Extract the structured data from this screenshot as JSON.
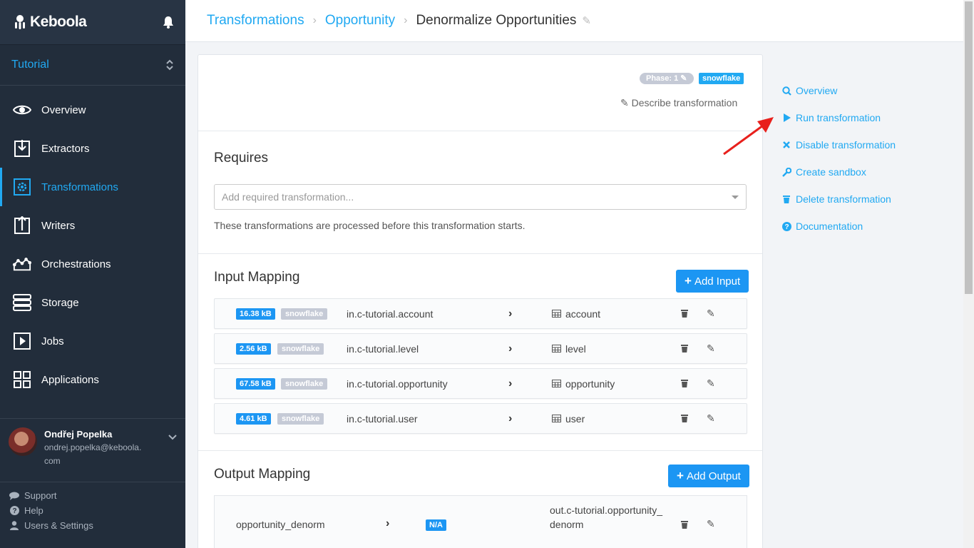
{
  "app": {
    "logo_text": "Keboola"
  },
  "project": {
    "name": "Tutorial"
  },
  "sidebar": {
    "items": [
      {
        "label": "Overview",
        "icon": "eye-icon"
      },
      {
        "label": "Extractors",
        "icon": "download-icon"
      },
      {
        "label": "Transformations",
        "icon": "gear-icon",
        "active": true
      },
      {
        "label": "Writers",
        "icon": "upload-icon"
      },
      {
        "label": "Orchestrations",
        "icon": "orchestration-icon"
      },
      {
        "label": "Storage",
        "icon": "storage-icon"
      },
      {
        "label": "Jobs",
        "icon": "play-icon"
      },
      {
        "label": "Applications",
        "icon": "grid-icon"
      }
    ],
    "user": {
      "name": "Ondřej Popelka",
      "email": "ondrej.popelka@keboola.com"
    },
    "links": [
      {
        "label": "Support",
        "icon": "chat-icon"
      },
      {
        "label": "Help",
        "icon": "question-icon"
      },
      {
        "label": "Users & Settings",
        "icon": "user-icon"
      }
    ]
  },
  "breadcrumb": {
    "items": [
      "Transformations",
      "Opportunity"
    ],
    "current": "Denormalize Opportunities"
  },
  "transformation": {
    "phase_badge": "Phase: 1",
    "backend_badge": "snowflake",
    "describe_label": "Describe transformation"
  },
  "requires": {
    "title": "Requires",
    "placeholder": "Add required transformation...",
    "help": "These transformations are processed before this transformation starts."
  },
  "input_mapping": {
    "title": "Input Mapping",
    "add_label": "Add Input",
    "rows": [
      {
        "size": "16.38 kB",
        "backend": "snowflake",
        "source": "in.c-tutorial.account",
        "destination": "account"
      },
      {
        "size": "2.56 kB",
        "backend": "snowflake",
        "source": "in.c-tutorial.level",
        "destination": "level"
      },
      {
        "size": "67.58 kB",
        "backend": "snowflake",
        "source": "in.c-tutorial.opportunity",
        "destination": "opportunity"
      },
      {
        "size": "4.61 kB",
        "backend": "snowflake",
        "source": "in.c-tutorial.user",
        "destination": "user"
      }
    ]
  },
  "output_mapping": {
    "title": "Output Mapping",
    "add_label": "Add Output",
    "rows": [
      {
        "source": "opportunity_denorm",
        "size": "N/A",
        "destination": "out.c-tutorial.opportunity_denorm"
      }
    ]
  },
  "actions": [
    {
      "label": "Overview",
      "icon": "search-icon"
    },
    {
      "label": "Run transformation",
      "icon": "play-icon"
    },
    {
      "label": "Disable transformation",
      "icon": "close-icon"
    },
    {
      "label": "Create sandbox",
      "icon": "wrench-icon"
    },
    {
      "label": "Delete transformation",
      "icon": "trash-icon"
    },
    {
      "label": "Documentation",
      "icon": "question-icon"
    }
  ],
  "colors": {
    "accent": "#21a9f2",
    "sidebar": "#222d3b",
    "button": "#1c96f3",
    "annotation_arrow": "#e8201c"
  }
}
